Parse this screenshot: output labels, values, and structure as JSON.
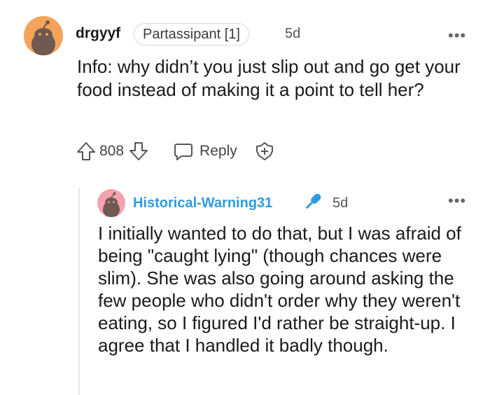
{
  "comment": {
    "username": "drgyyf",
    "flair": "Partassipant [1]",
    "time": "5d",
    "more": "•••",
    "body": "Info: why didn’t you just slip out and go get your food instead of making it a point to tell her?",
    "score": "808",
    "reply_label": "Reply"
  },
  "reply": {
    "username": "Historical-Warning31",
    "time": "5d",
    "more": "•••",
    "body": "I initially wanted to do that, but I was afraid of being \"caught lying\" (though chances were slim). She was also going around asking the few people who didn't order why they weren't eating, so I figured I'd rather be straight-up. I agree that I handled it badly though."
  },
  "icons": {
    "avatar1": "snoo-avatar-icon",
    "avatar2": "snoo-avatar-icon",
    "upvote": "upvote-arrow-icon",
    "downvote": "downvote-arrow-icon",
    "reply": "speech-bubble-icon",
    "award": "award-plus-icon",
    "mic": "microphone-icon"
  },
  "colors": {
    "avatar1_bg": "#f5a25a",
    "avatar2_bg": "#f4a3ae",
    "reply_username": "#2f9ae0",
    "mic": "#2f9ae0"
  }
}
